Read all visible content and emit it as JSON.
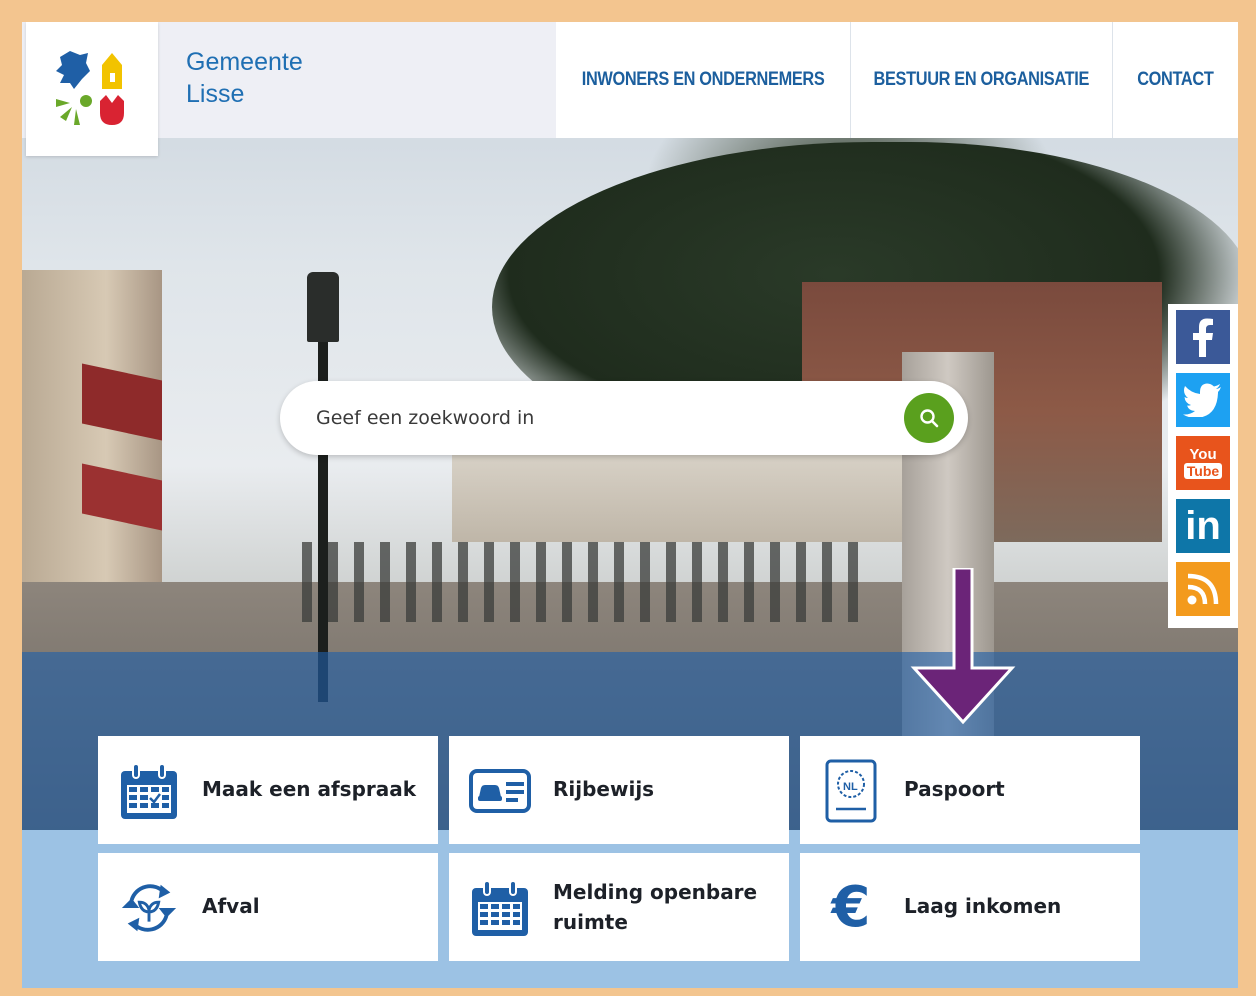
{
  "brand": {
    "line1": "Gemeente",
    "line2": "Lisse"
  },
  "nav": [
    {
      "label": "INWONERS EN ONDERNEMERS"
    },
    {
      "label": "BESTUUR EN ORGANISATIE"
    },
    {
      "label": "CONTACT"
    }
  ],
  "search": {
    "placeholder": "Geef een zoekwoord in",
    "icon": "search-icon"
  },
  "social": [
    {
      "name": "facebook",
      "color": "#3b5998"
    },
    {
      "name": "twitter",
      "color": "#1da1f2"
    },
    {
      "name": "youtube",
      "color": "#e8541c",
      "text1": "You",
      "text2": "Tube"
    },
    {
      "name": "linkedin",
      "color": "#0e76a8",
      "text": "in"
    },
    {
      "name": "rss",
      "color": "#f39a1d"
    }
  ],
  "tiles": [
    {
      "label": "Maak een afspraak",
      "icon": "calendar-check-icon"
    },
    {
      "label": "Rijbewijs",
      "icon": "driving-licence-icon"
    },
    {
      "label": "Paspoort",
      "icon": "passport-icon",
      "icon_text": "NL"
    },
    {
      "label": "Afval",
      "icon": "recycle-leaf-icon"
    },
    {
      "label_line1": "Melding openbare",
      "label_line2": "ruimte",
      "icon": "calendar-grid-icon"
    },
    {
      "label": "Laag inkomen",
      "icon": "euro-icon",
      "icon_text": "€"
    }
  ],
  "colors": {
    "brand_blue": "#1f6fb3",
    "nav_blue": "#1c5f9e",
    "icon_blue": "#1f5fa6",
    "search_green": "#5aa01e",
    "arrow_purple": "#6b2478",
    "page_border": "#f3c58f",
    "tiles_band": "#9cc2e4"
  }
}
